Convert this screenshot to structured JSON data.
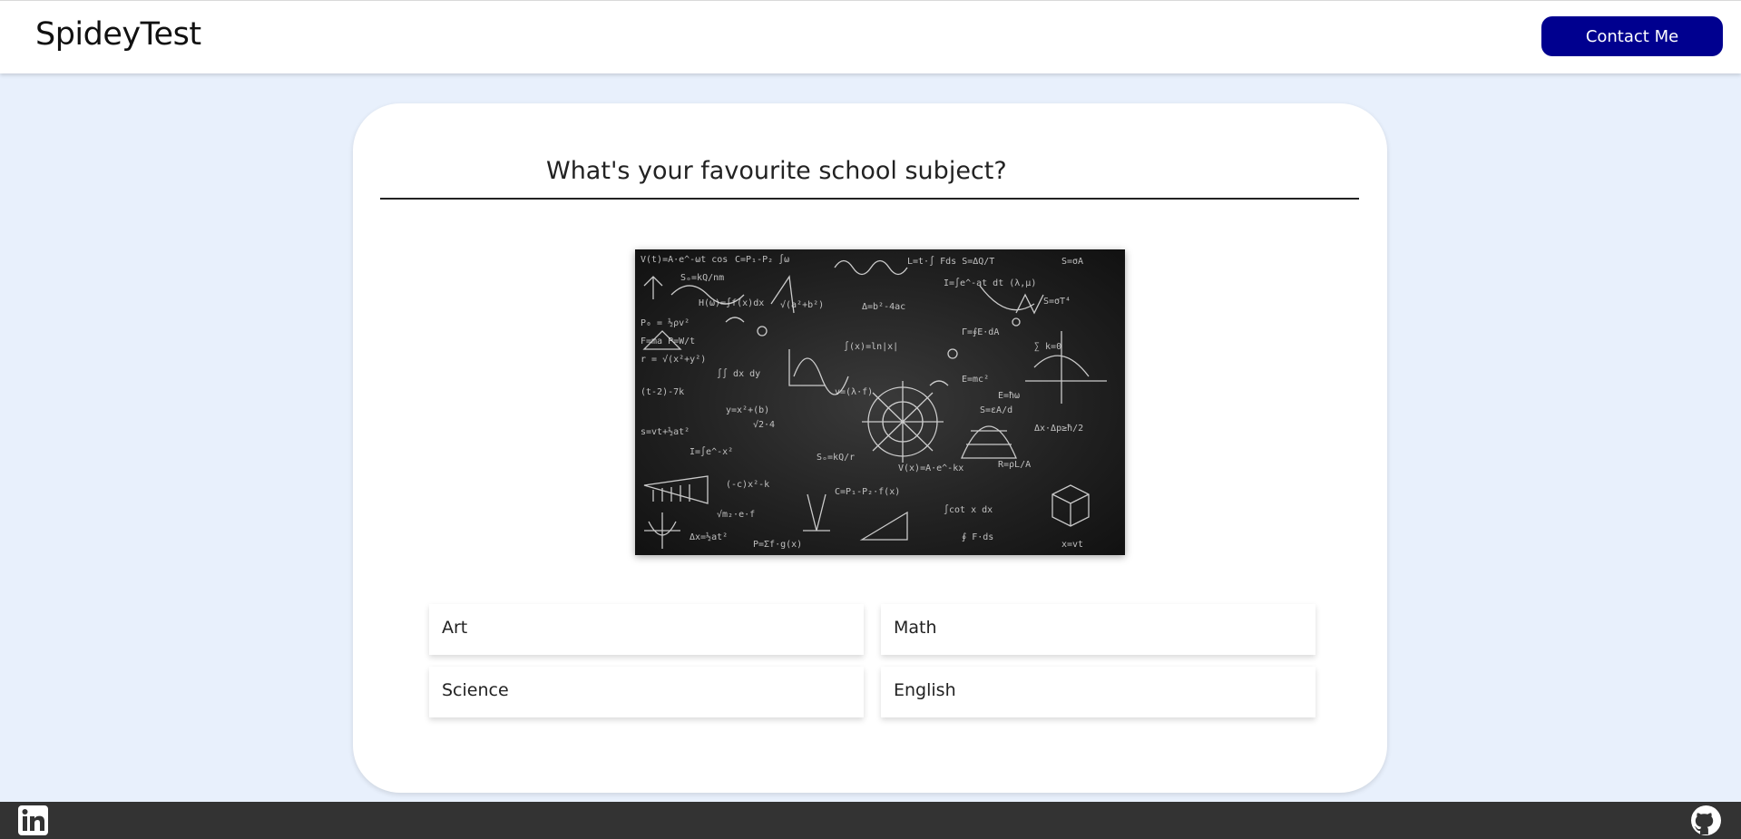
{
  "navbar": {
    "brand": "SpideyTest",
    "contact_label": "Contact Me",
    "contact_color": "#00008f"
  },
  "quiz": {
    "question": "What's your favourite school subject?",
    "image_icon": "chalkboard-equations",
    "options": [
      {
        "label": "Art"
      },
      {
        "label": "Math"
      },
      {
        "label": "Science"
      },
      {
        "label": "English"
      }
    ]
  },
  "footer": {
    "icons": [
      "linkedin-icon",
      "github-icon"
    ]
  },
  "colors": {
    "background": "#e8f0fc",
    "footer": "#333333"
  }
}
